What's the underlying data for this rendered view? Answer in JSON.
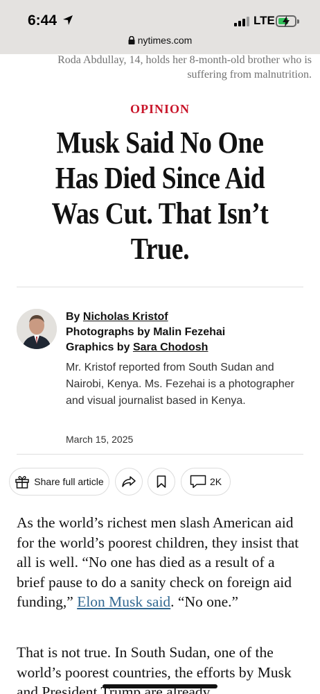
{
  "status": {
    "time": "6:44",
    "network": "LTE",
    "url": "nytimes.com"
  },
  "article": {
    "photo_caption": "Roda Abdullay, 14, holds her 8-month-old brother who is suffering from malnutrition.",
    "kicker": "OPINION",
    "headline": "Musk Said No One Has Died Since Aid Was Cut. That Isn’t True.",
    "byline": {
      "by_prefix": "By",
      "author": "Nicholas Kristof",
      "photographs": "Photographs by Malin Fezehai",
      "graphics_prefix": "Graphics by",
      "graphics_author": "Sara Chodosh",
      "note": "Mr. Kristof reported from South Sudan and Nairobi, Kenya. Ms. Fezehai is a photographer and visual journalist based in Kenya.",
      "date": "March 15, 2025"
    },
    "actions": {
      "share_label": "Share full article",
      "comment_count": "2K"
    },
    "body": {
      "p1_text": "As the world’s richest men slash American aid for the world’s poorest children, they insist that all is well. “No one has died as a result of a brief pause to do a sanity check on foreign aid funding,”",
      "p1_link": "Elon Musk said",
      "p1_after": ". “No one.”",
      "p2_text": "That is not true. In South Sudan, one of the world’s poorest countries, the efforts by Musk and President Trump are already"
    }
  },
  "icons": [
    "location-arrow-icon",
    "signal-icon",
    "battery-charging-icon",
    "lock-icon",
    "gift-icon",
    "forward-icon",
    "bookmark-icon",
    "comment-icon"
  ]
}
